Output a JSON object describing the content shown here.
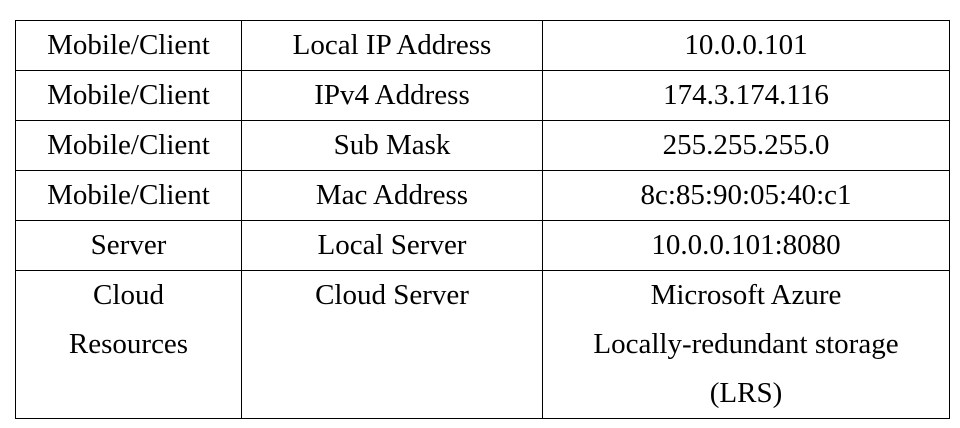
{
  "table": {
    "rows": [
      {
        "component": "Mobile/Client",
        "parameter": "Local IP Address",
        "value": "10.0.0.101"
      },
      {
        "component": "Mobile/Client",
        "parameter": "IPv4 Address",
        "value": "174.3.174.116"
      },
      {
        "component": "Mobile/Client",
        "parameter": "Sub Mask",
        "value": "255.255.255.0"
      },
      {
        "component": "Mobile/Client",
        "parameter": "Mac Address",
        "value": "8c:85:90:05:40:c1"
      },
      {
        "component": "Server",
        "parameter": "Local Server",
        "value": "10.0.0.101:8080"
      }
    ],
    "last_row": {
      "component_lines": [
        "Cloud",
        "Resources"
      ],
      "parameter": "Cloud Server",
      "value_lines": [
        "Microsoft Azure",
        "Locally-redundant storage",
        "(LRS)"
      ]
    }
  }
}
